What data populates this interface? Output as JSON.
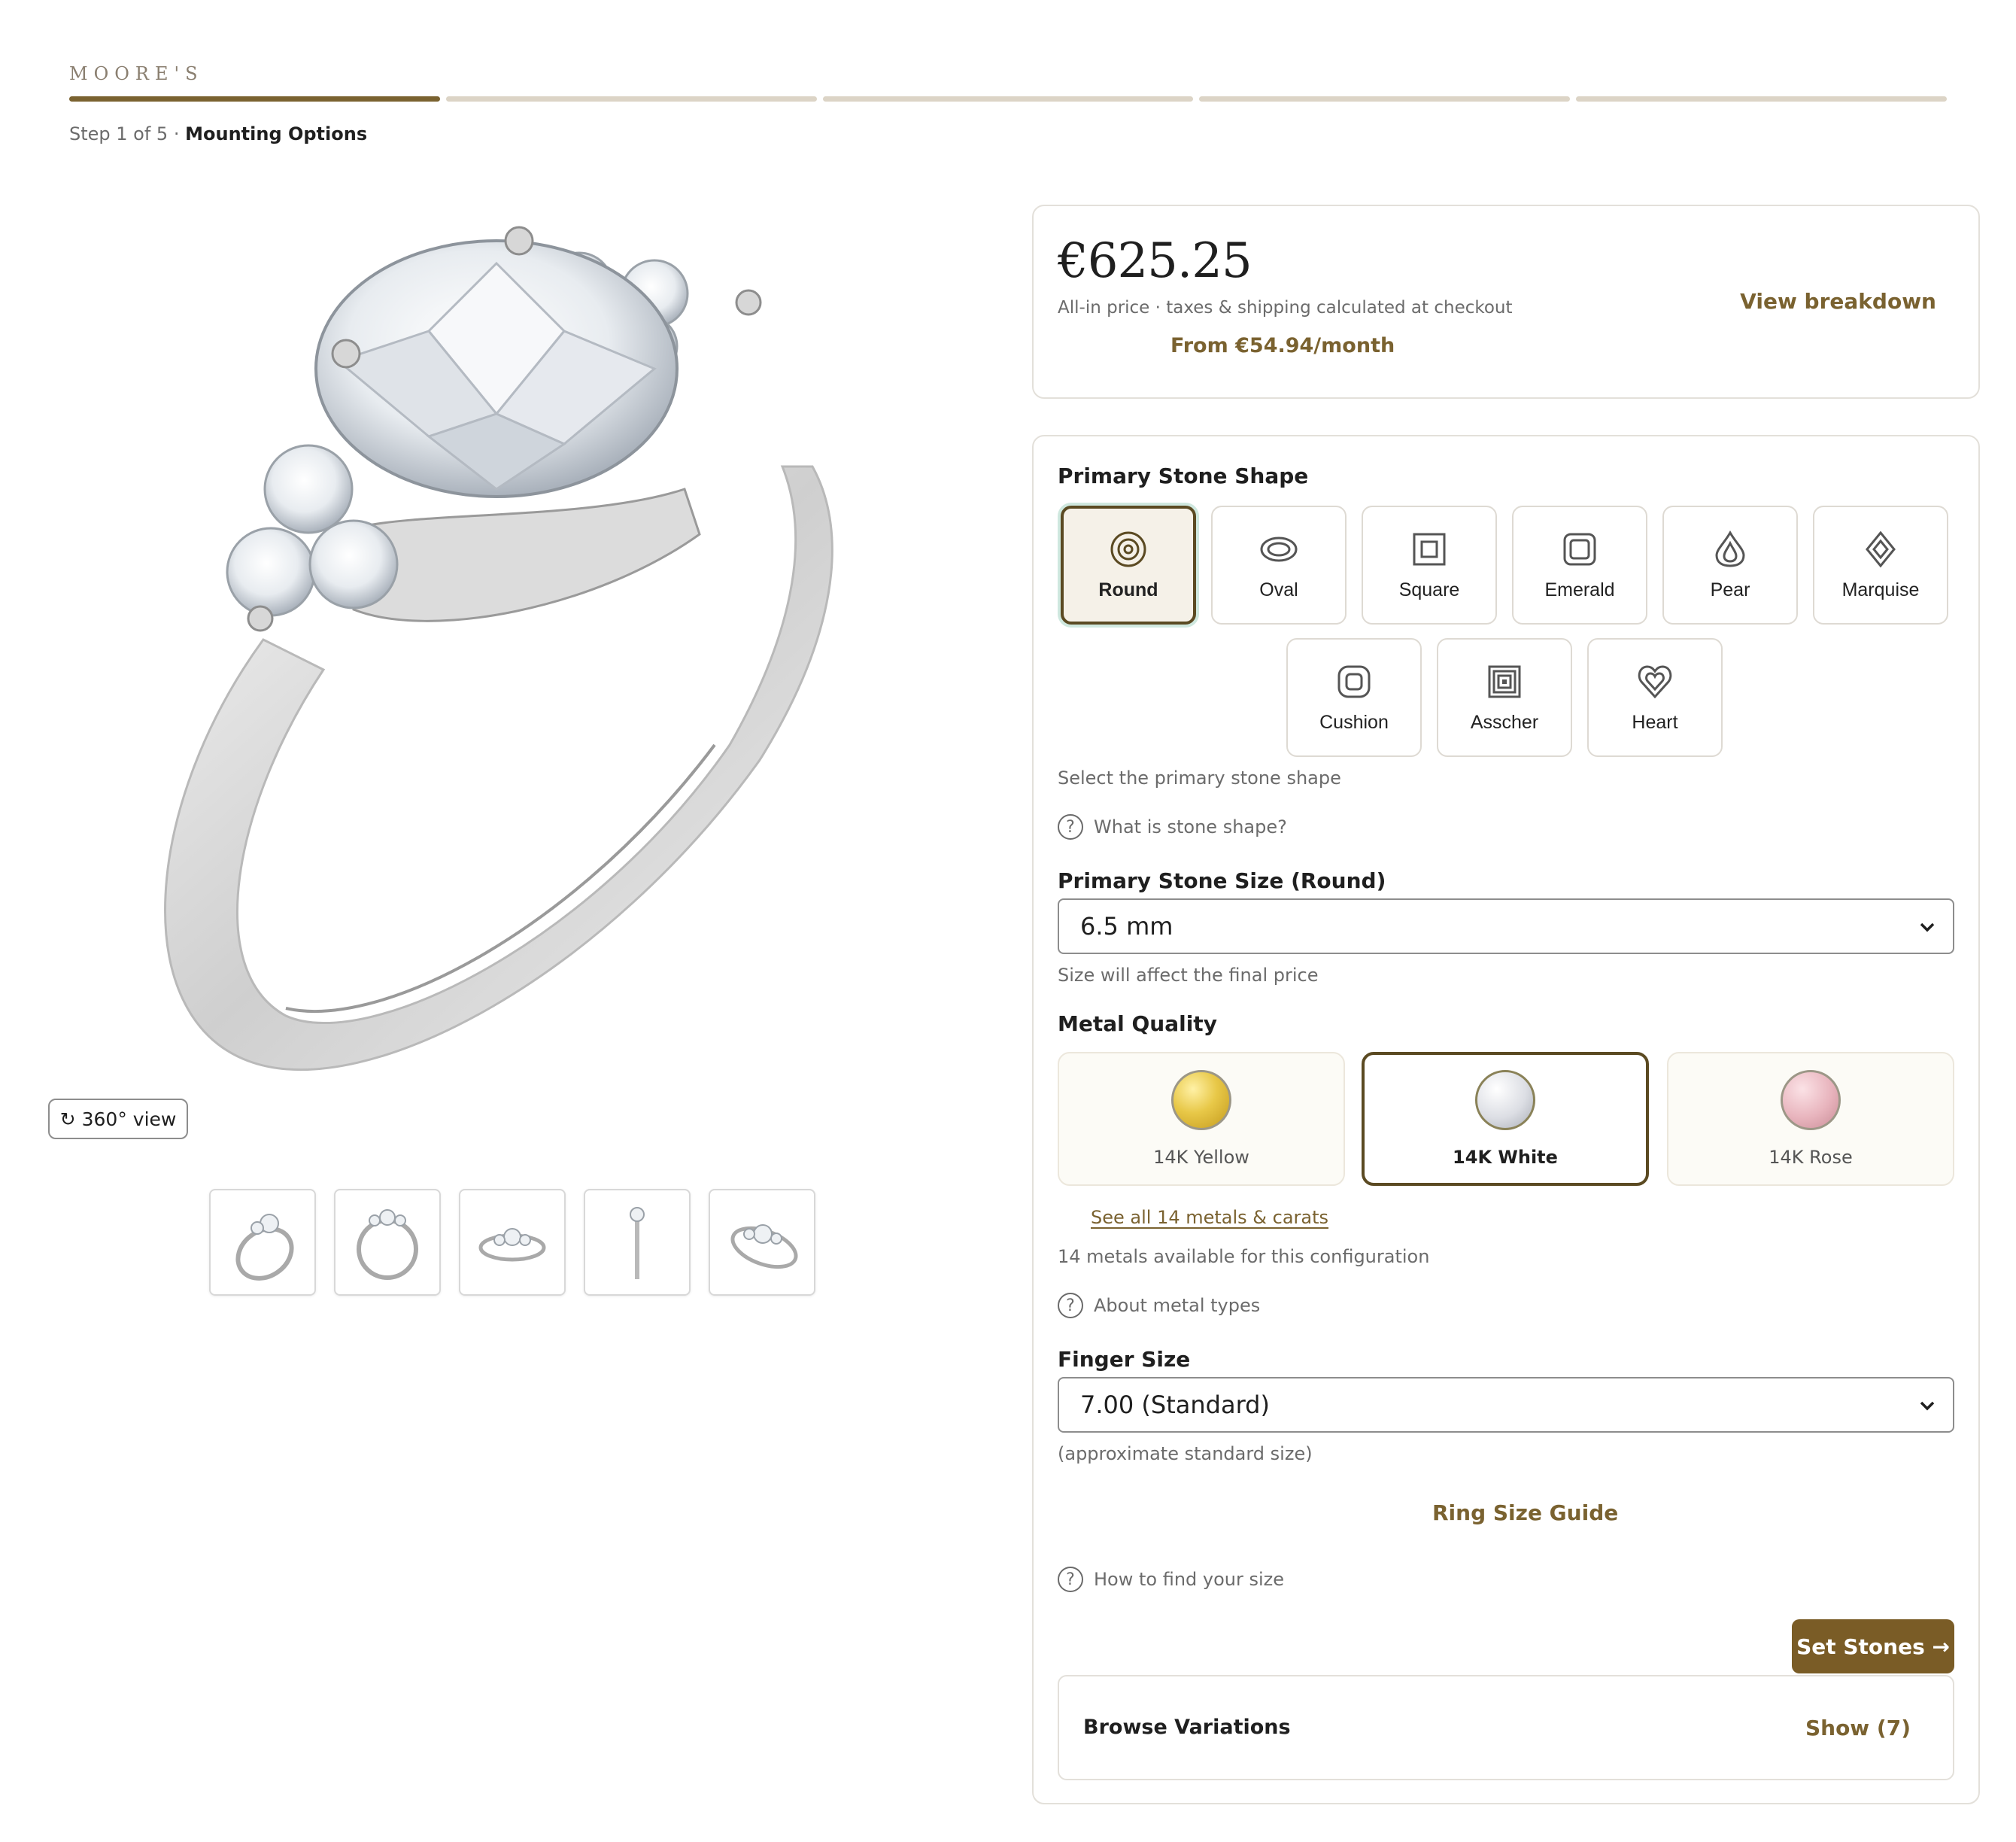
{
  "brand": "MOORE'S",
  "step": {
    "prefix": "Step 1 of 5 ·",
    "title": "Mounting Options",
    "current": 1,
    "total": 5
  },
  "gallery": {
    "view360_label": "360° view",
    "thumbnails": [
      "angle-view",
      "front-view",
      "side-view",
      "profile-view",
      "top-view"
    ]
  },
  "price": {
    "amount": "€625.25",
    "note": "All-in price · taxes & shipping calculated at checkout",
    "monthly": "From €54.94/month",
    "breakdown_label": "View breakdown"
  },
  "stone_shape": {
    "label": "Primary Stone Shape",
    "selected": "Round",
    "shapes": [
      "Round",
      "Oval",
      "Square",
      "Emerald",
      "Pear",
      "Marquise",
      "Cushion",
      "Asscher",
      "Heart"
    ],
    "help": "Select the primary stone shape",
    "info_link": "What is stone shape?"
  },
  "stone_size": {
    "label": "Primary Stone Size (Round)",
    "value": "6.5 mm",
    "help": "Size will affect the final price"
  },
  "metal": {
    "label": "Metal Quality",
    "options": [
      {
        "name": "14K Yellow",
        "color": "#e0bf3e"
      },
      {
        "name": "14K White",
        "color": "#d6d8de"
      },
      {
        "name": "14K Rose",
        "color": "#e4aeb8"
      }
    ],
    "selected": "14K White",
    "see_all": "See all 14 metals & carats",
    "available": "14 metals available for this configuration",
    "info_link": "About metal types"
  },
  "finger_size": {
    "label": "Finger Size",
    "value": "7.00 (Standard)",
    "help": "(approximate standard size)",
    "guide_label": "Ring Size Guide",
    "info_link": "How to find your size"
  },
  "cta_label": "Set Stones →",
  "variations": {
    "title": "Browse Variations",
    "toggle": "Show (7)"
  },
  "colors": {
    "accent": "#7a6230",
    "cta": "#7a5c26",
    "progress_track": "#dcd4c6"
  }
}
